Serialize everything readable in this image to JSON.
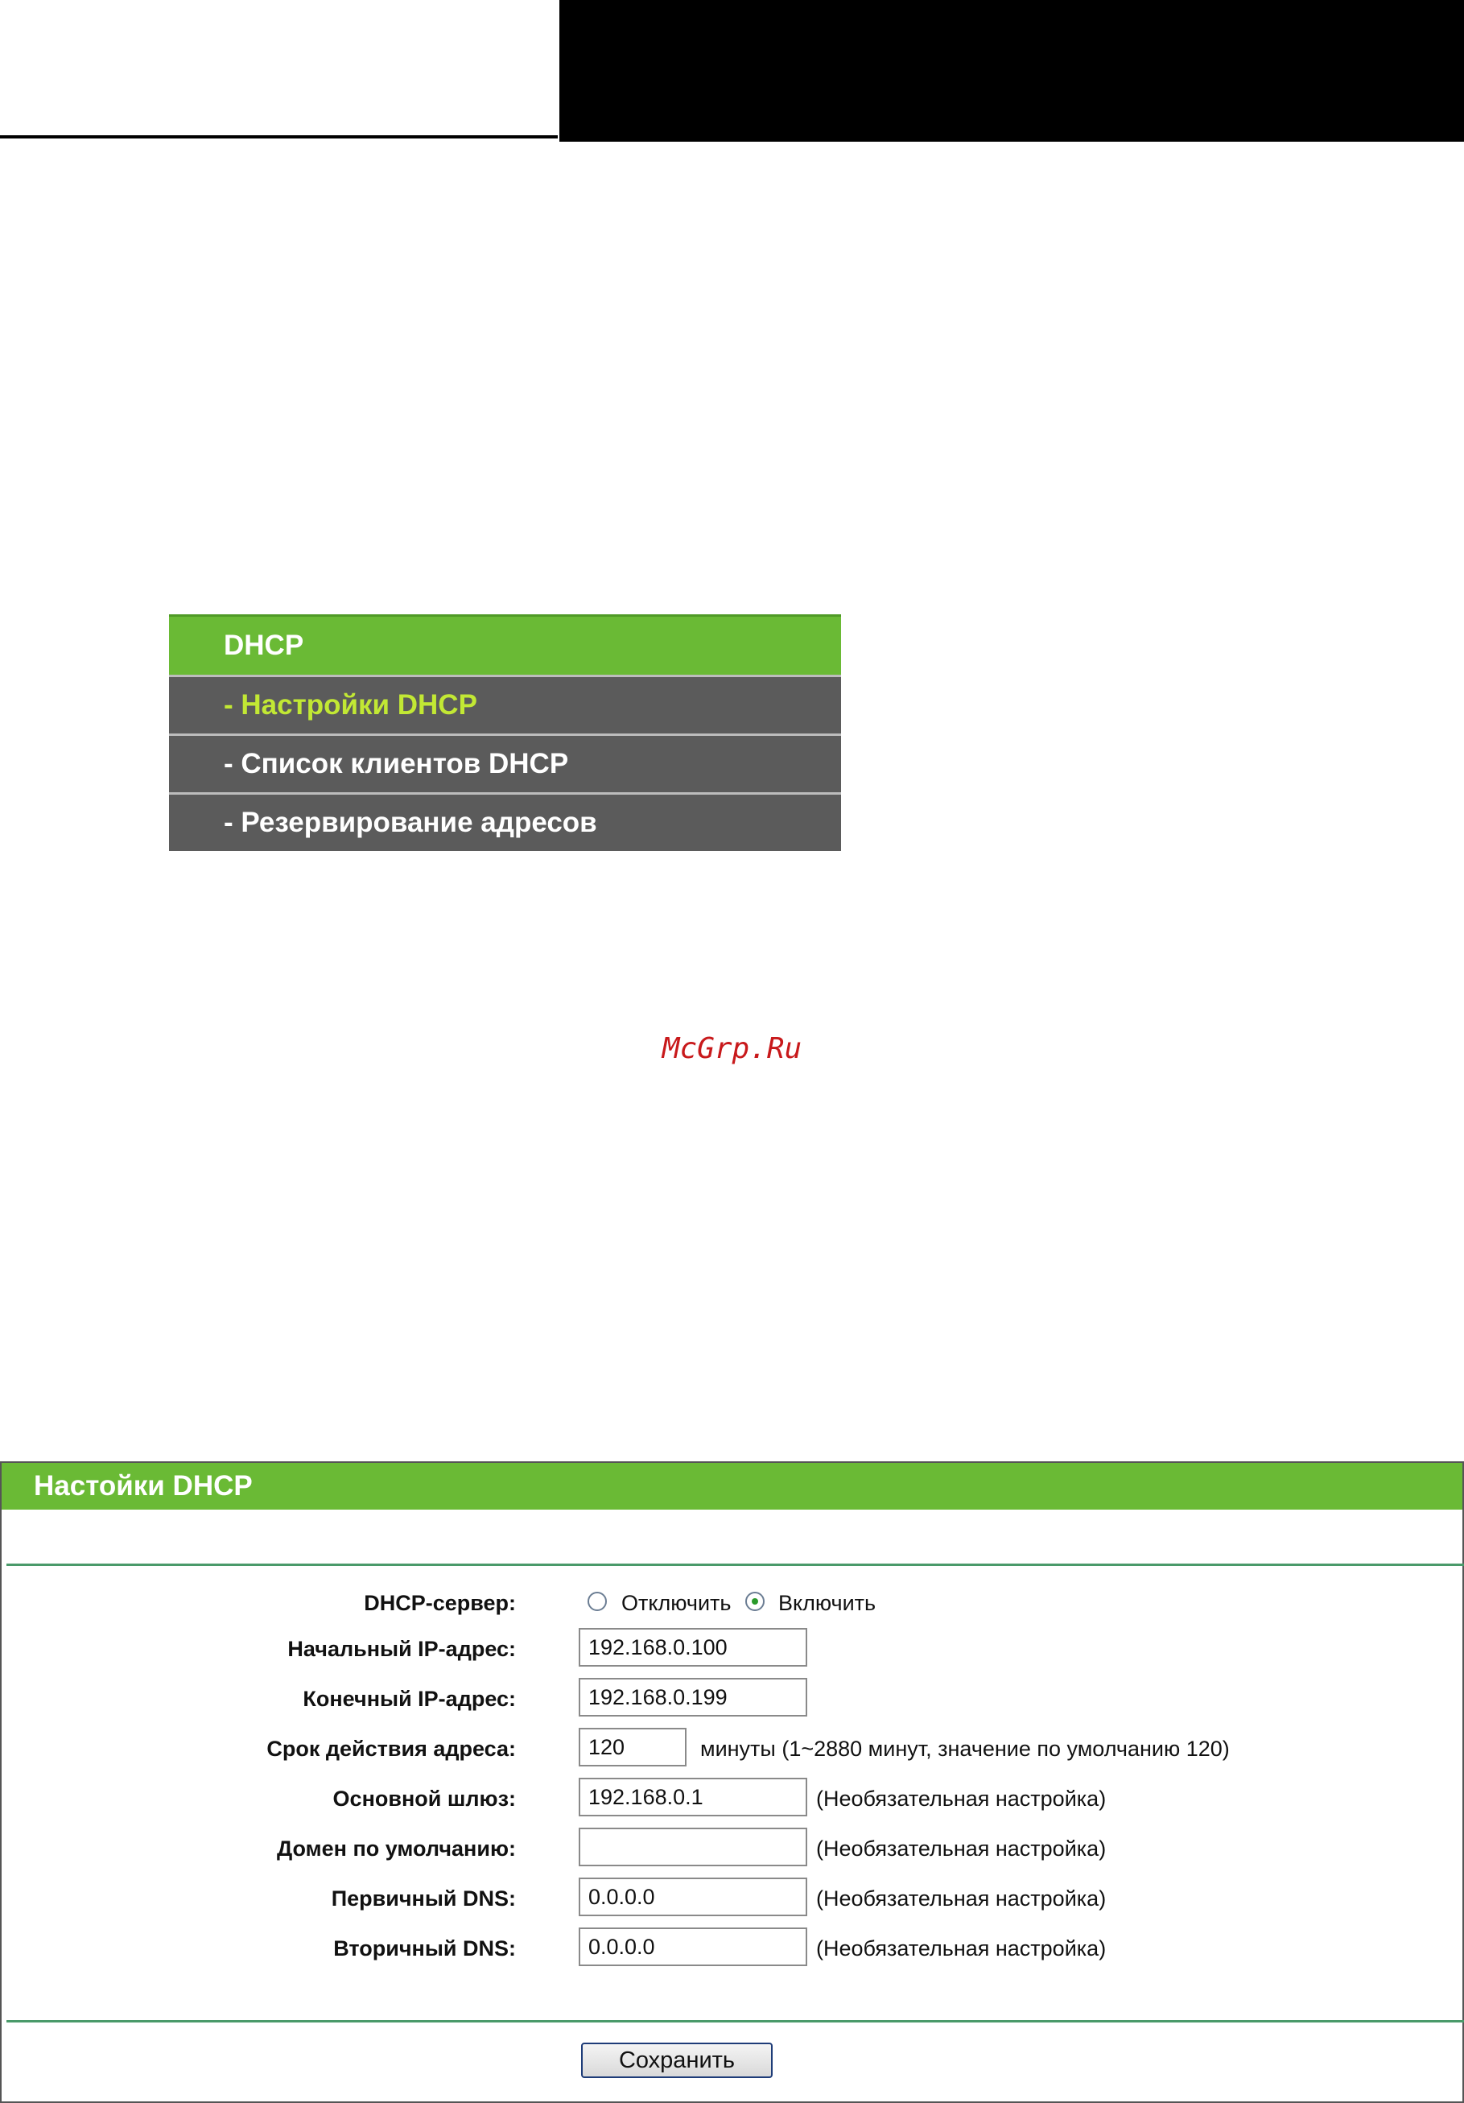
{
  "menu": {
    "header": "DHCP",
    "items": [
      {
        "label": "- Настройки DHCP",
        "active": true
      },
      {
        "label": "- Список клиентов DHCP",
        "active": false
      },
      {
        "label": "- Резервирование адресов",
        "active": false
      }
    ]
  },
  "watermark": "McGrp.Ru",
  "panel": {
    "title": "Настойки DHCP",
    "dhcp_server": {
      "label": "DHCP-сервер:",
      "option_off": "Отключить",
      "option_on": "Включить",
      "selected": "Включить"
    },
    "start_ip": {
      "label": "Начальный IP-адрес:",
      "value": "192.168.0.100"
    },
    "end_ip": {
      "label": "Конечный IP-адрес:",
      "value": "192.168.0.199"
    },
    "lease_time": {
      "label": "Срок действия адреса:",
      "value": "120",
      "hint": "минуты (1~2880 минут, значение по умолчанию 120)"
    },
    "gateway": {
      "label": "Основной шлюз:",
      "value": "192.168.0.1",
      "hint": "(Необязательная настройка)"
    },
    "domain": {
      "label": "Домен по умолчанию:",
      "value": "",
      "hint": "(Необязательная настройка)"
    },
    "primary_dns": {
      "label": "Первичный DNS:",
      "value": "0.0.0.0",
      "hint": "(Необязательная настройка)"
    },
    "secondary_dns": {
      "label": "Вторичный DNS:",
      "value": "0.0.0.0",
      "hint": "(Необязательная настройка)"
    },
    "save_label": "Сохранить"
  },
  "colors": {
    "accent_green": "#6aba35",
    "menu_gray": "#5b5b5b",
    "active_item": "#c2e834",
    "watermark_red": "#c8191b"
  }
}
